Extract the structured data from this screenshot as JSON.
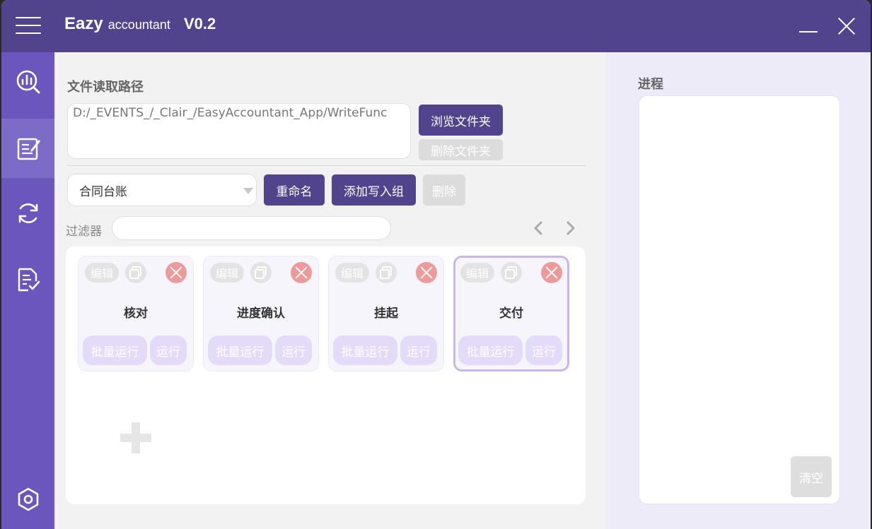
{
  "titlebar": {
    "title_part1": "Eazy",
    "title_part2": "accountant",
    "version": "V0.2",
    "menu_icon": "hamburger-icon",
    "minimize_icon": "minimize-icon",
    "close_icon": "close-icon"
  },
  "sidebar": {
    "items": [
      {
        "icon": "analytics-icon",
        "active": false
      },
      {
        "icon": "edit-document-icon",
        "active": true
      },
      {
        "icon": "sync-icon",
        "active": false
      },
      {
        "icon": "checklist-icon",
        "active": false
      }
    ],
    "bottom_icon": "settings-hexagon-icon"
  },
  "file_path": {
    "label": "文件读取路径",
    "value": "D:/_EVENTS_/_Clair_/EasyAccountant_App/WriteFunc",
    "browse_label": "浏览文件夹",
    "delete_label": "删除文件夹"
  },
  "group": {
    "selected": "合同台账",
    "rename_label": "重命名",
    "add_label": "添加写入组",
    "delete_label": "删除"
  },
  "filter": {
    "label": "过滤器",
    "value": ""
  },
  "cards": [
    {
      "name": "核对",
      "edit": "编辑",
      "batch_run": "批量运行",
      "run": "运行",
      "selected": false
    },
    {
      "name": "进度确认",
      "edit": "编辑",
      "batch_run": "批量运行",
      "run": "运行",
      "selected": false
    },
    {
      "name": "挂起",
      "edit": "编辑",
      "batch_run": "批量运行",
      "run": "运行",
      "selected": false
    },
    {
      "name": "交付",
      "edit": "编辑",
      "batch_run": "批量运行",
      "run": "运行",
      "selected": true
    }
  ],
  "progress": {
    "label": "进程",
    "clear_label": "清空"
  },
  "colors": {
    "titlebar": "#52438d",
    "sidebar": "#6a56bd",
    "primary_button": "#52438d",
    "delete_red": "#ef9a9a",
    "run_button": "#e3dbf8"
  }
}
